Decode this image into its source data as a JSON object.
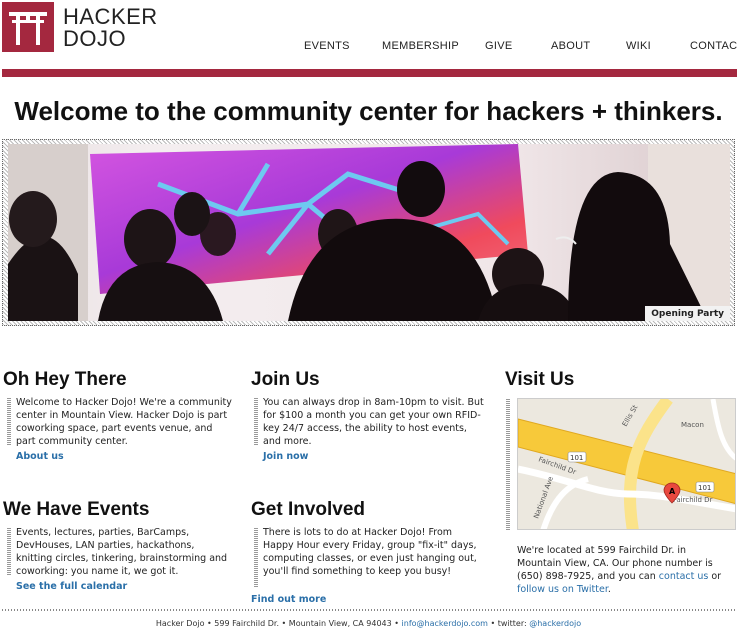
{
  "brand": {
    "line1": "HACKER",
    "line2": "DOJO",
    "accent": "#a4283f",
    "icon": "torii-gate-icon"
  },
  "nav": [
    "EVENTS",
    "MEMBERSHIP",
    "GIVE",
    "ABOUT",
    "WIKI",
    "CONTACT"
  ],
  "headline": "Welcome to the community center for hackers + thinkers.",
  "hero": {
    "caption": "Opening Party"
  },
  "sections": {
    "hey": {
      "title": "Oh Hey There",
      "body": "Welcome to Hacker Dojo! We're a community center in Mountain View. Hacker Dojo is part coworking space, part events venue, and part community center.",
      "link": "About us"
    },
    "join": {
      "title": "Join Us",
      "body": "You can always drop in 8am-10pm to visit. But for $100 a month you can get your own RFID-key 24/7 access, the ability to host events, and more.",
      "link": "Join now"
    },
    "events": {
      "title": "We Have Events",
      "body": "Events, lectures, parties, BarCamps, DevHouses, LAN parties, hackathons, knitting circles, tinkering, brainstorming and coworking: you name it, we got it.",
      "link": "See the full calendar"
    },
    "involved": {
      "title": "Get Involved",
      "body": "There is lots to do at Hacker Dojo! From Happy Hour every Friday, group \"fix-it\" days, computing classes, or even just hanging out, you'll find something to keep you busy!",
      "link": "Find out more"
    },
    "visit": {
      "title": "Visit Us",
      "text_before": "We're located at 599 Fairchild Dr. in Mountain View, CA. Our phone number is (650) 898-7925, and you can ",
      "contact_link": "contact us",
      "text_mid": " or ",
      "twitter_link": "follow us on Twitter",
      "text_after": "."
    }
  },
  "map": {
    "labels": [
      "Ellis St",
      "Fairchild Dr",
      "Fairchild Dr",
      "National Ave",
      "Macon",
      "101",
      "101"
    ],
    "marker": "A"
  },
  "footer": {
    "address": "Hacker Dojo • 599 Fairchild Dr. • Mountain View, CA 94043 • ",
    "email": "info@hackerdojo.com",
    "twitter_label": " • twitter: ",
    "twitter": "@hackerdojo"
  }
}
